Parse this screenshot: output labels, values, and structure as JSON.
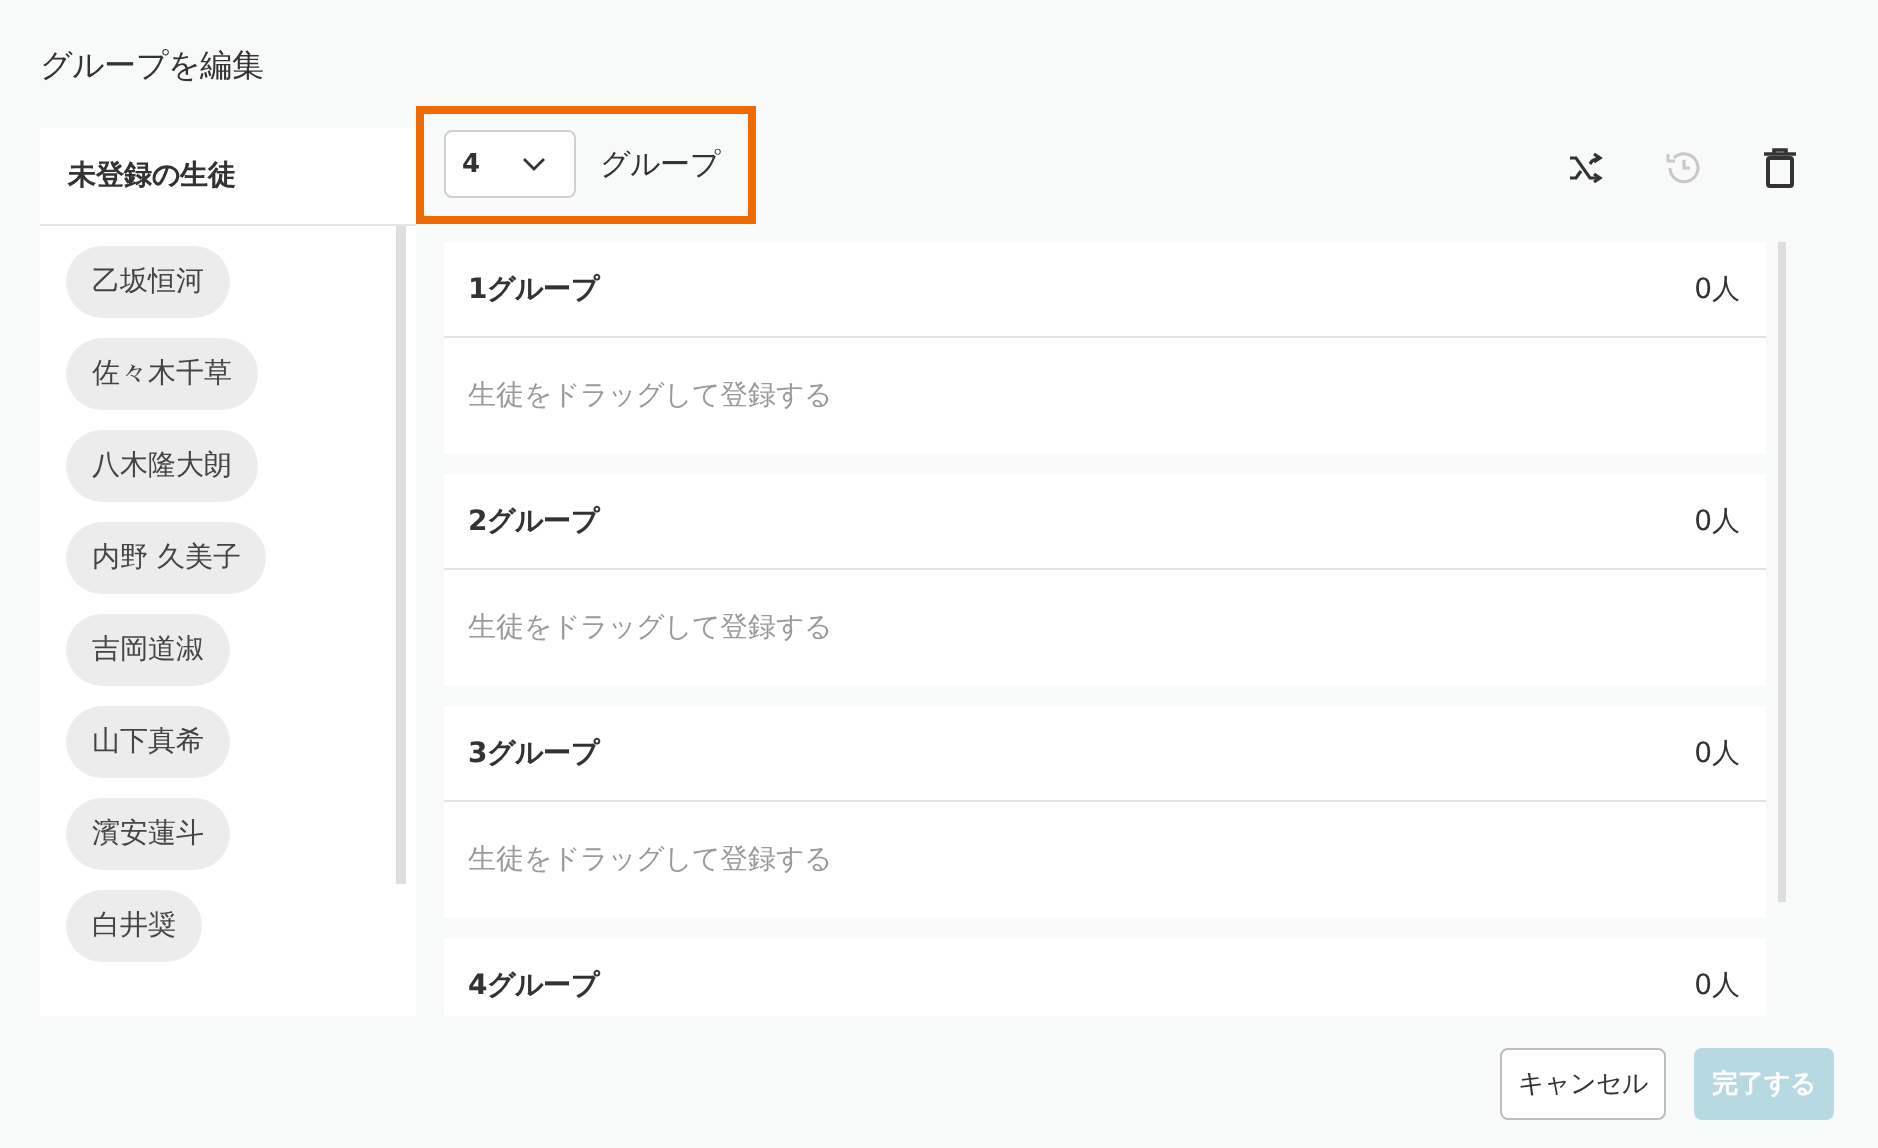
{
  "dialog": {
    "title": "グループを編集"
  },
  "unassigned": {
    "title": "未登録の生徒",
    "students": [
      "乙坂恒河",
      "佐々木千草",
      "八木隆大朗",
      "内野 久美子",
      "吉岡道淑",
      "山下真希",
      "濱安蓮斗",
      "白井奨"
    ]
  },
  "group_count": {
    "value": "4",
    "label": "グループ",
    "highlighted": true
  },
  "toolbar": [
    {
      "kind": "shuffle",
      "disabled": false
    },
    {
      "kind": "history",
      "disabled": true
    },
    {
      "kind": "delete",
      "disabled": false
    }
  ],
  "groups": [
    {
      "name": "1グループ",
      "count": "0人",
      "placeholder": "生徒をドラッグして登録する"
    },
    {
      "name": "2グループ",
      "count": "0人",
      "placeholder": "生徒をドラッグして登録する"
    },
    {
      "name": "3グループ",
      "count": "0人",
      "placeholder": "生徒をドラッグして登録する"
    },
    {
      "name": "4グループ",
      "count": "0人"
    }
  ],
  "buttons": [
    {
      "label": "キャンセル",
      "kind": "secondary",
      "disabled": false
    },
    {
      "label": "完了する",
      "kind": "primary",
      "disabled": true
    }
  ]
}
